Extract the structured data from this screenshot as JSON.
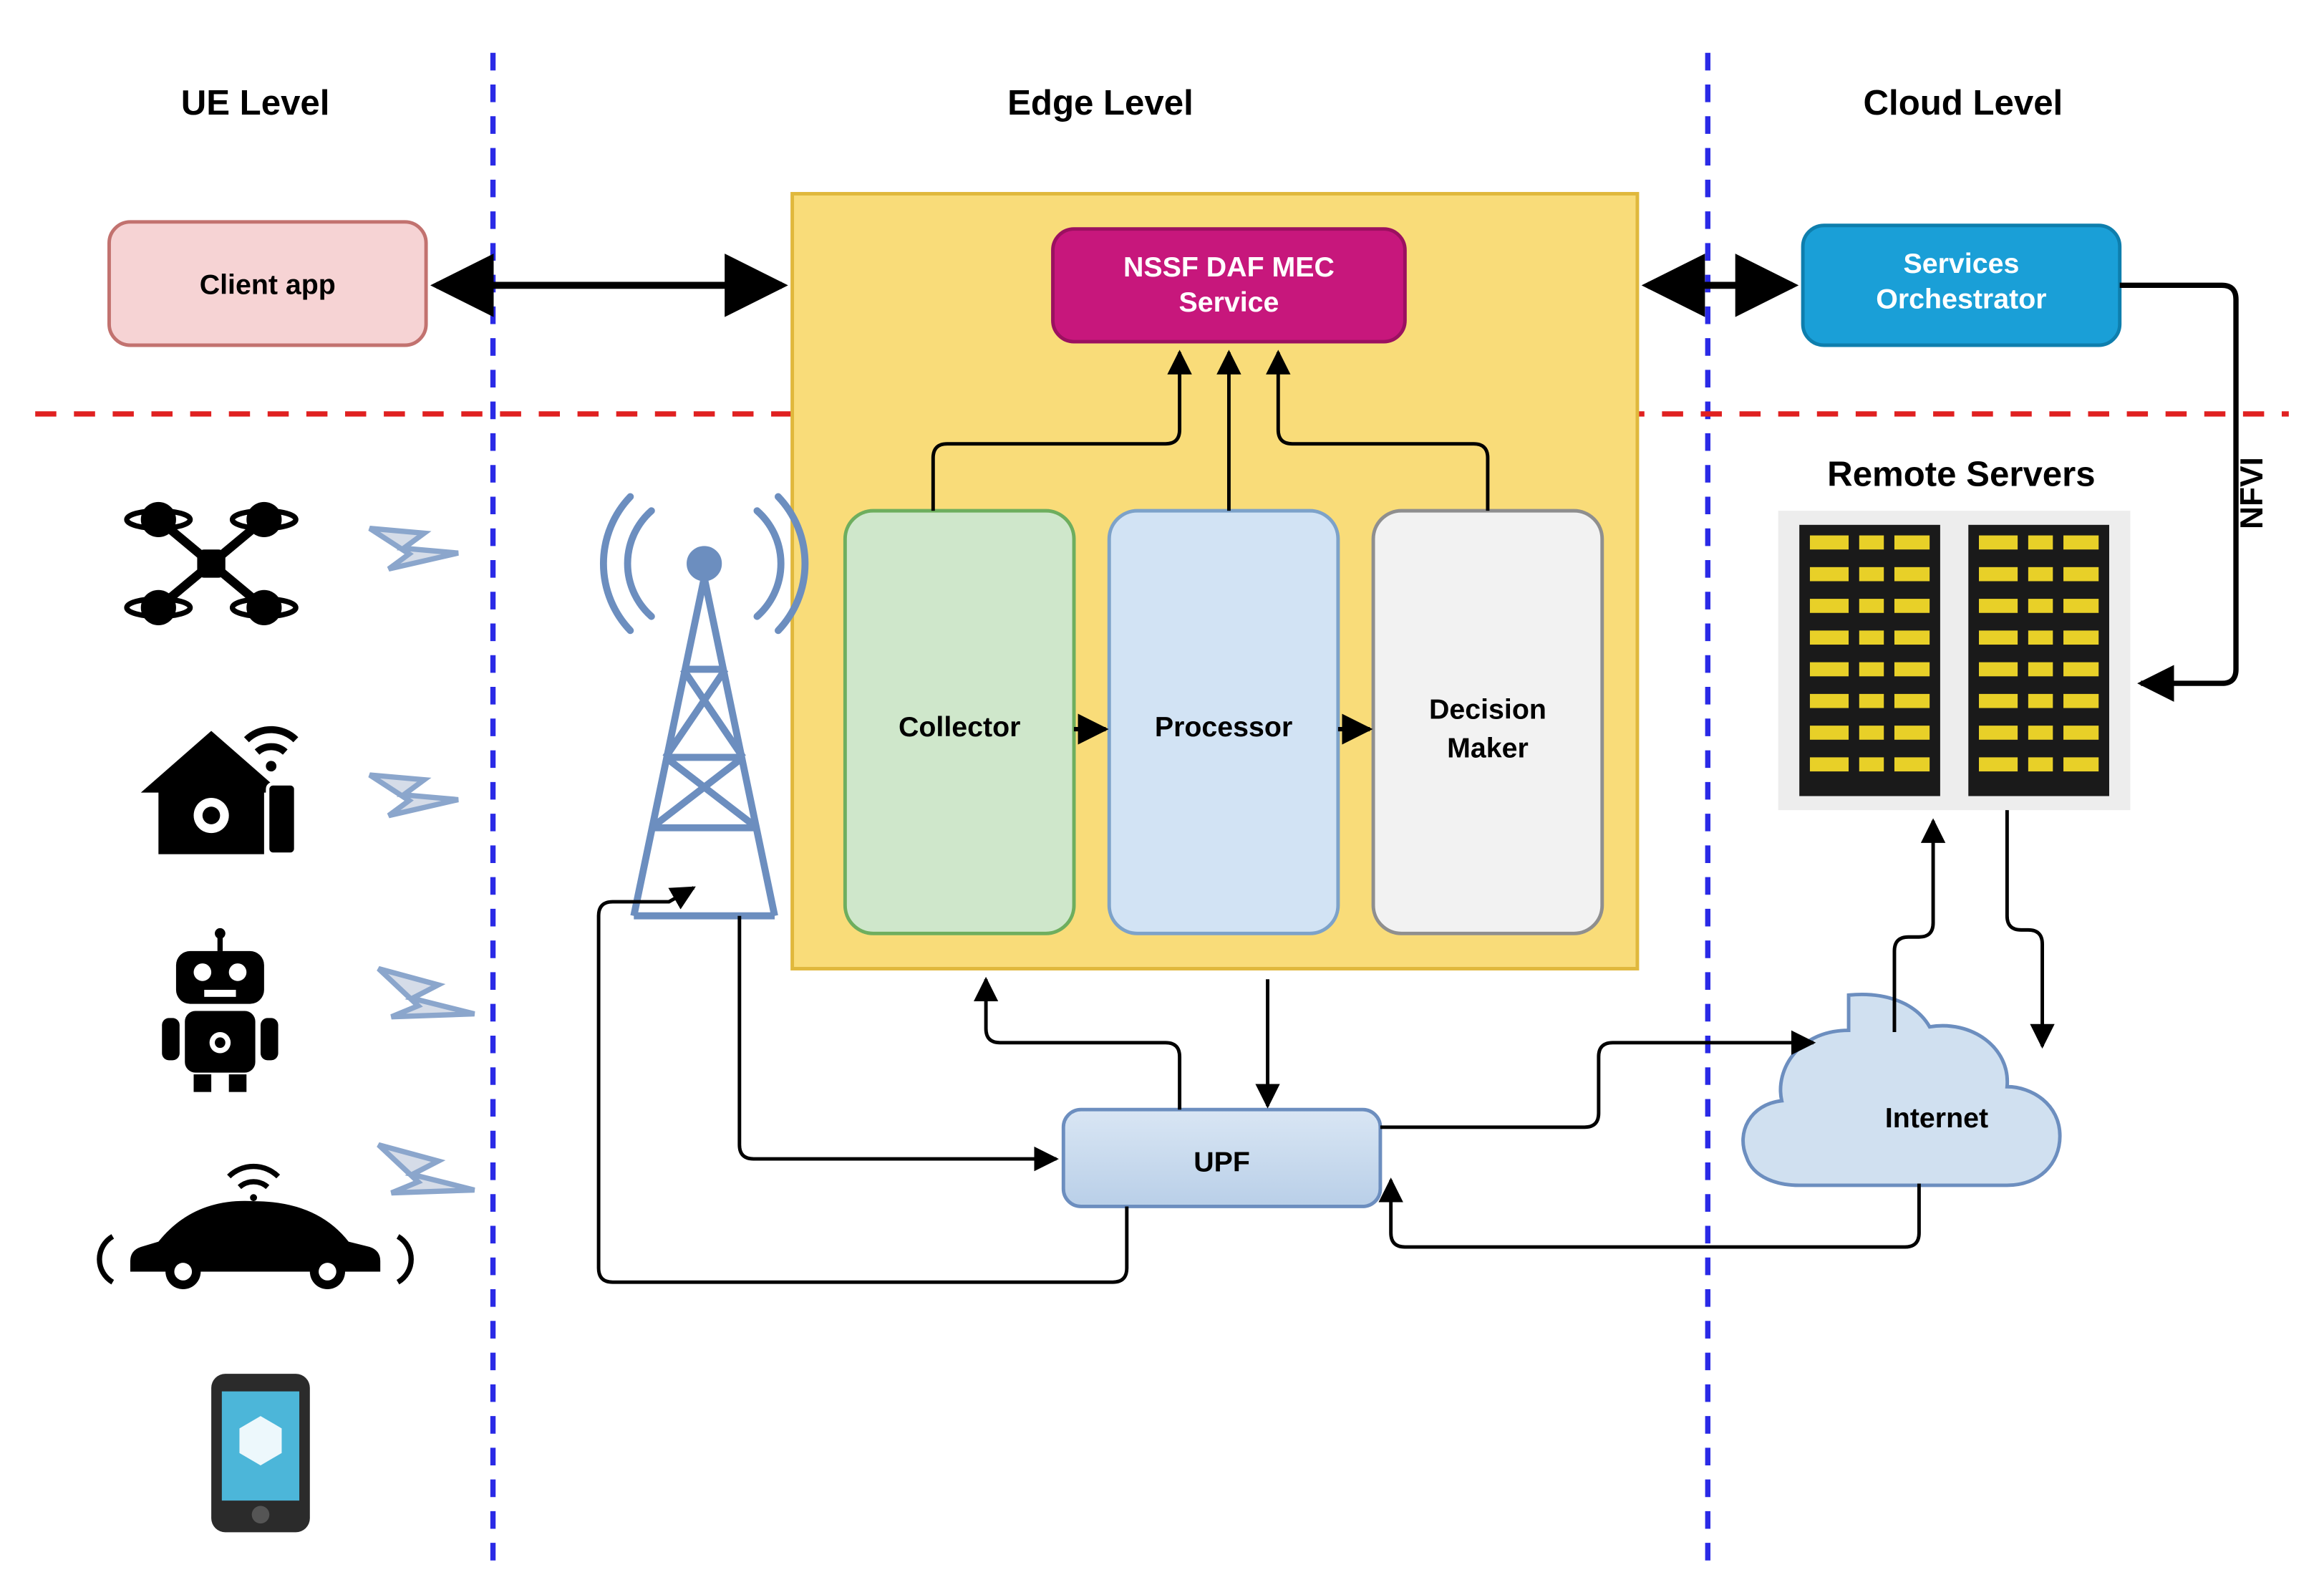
{
  "levels": {
    "ue": "UE Level",
    "edge": "Edge Level",
    "cloud": "Cloud Level"
  },
  "nodes": {
    "client_app": "Client app",
    "nssf_service": "NSSF DAF MEC Service",
    "services_orchestrator": "Services Orchestrator",
    "collector": "Collector",
    "processor": "Processor",
    "decision_maker": "Decision Maker",
    "upf": "UPF",
    "internet": "Internet",
    "remote_servers": "Remote Servers",
    "nfvi": "NFVI"
  },
  "icons": {
    "drone": "drone-icon",
    "smart_home": "smart-home-icon",
    "robot": "robot-icon",
    "car": "connected-car-icon",
    "phone": "smartphone-icon",
    "tower": "cell-tower-icon",
    "wireless": "wireless-signal-icon",
    "servers": "server-rack-icon",
    "cloud": "cloud-icon"
  },
  "colors": {
    "client_app_fill": "#F6D3D4",
    "client_app_stroke": "#C2726F",
    "edge_box_fill": "#F9DC79",
    "edge_box_stroke": "#E0B83C",
    "nssf_fill": "#C7177C",
    "nssf_text": "#FFFFFF",
    "orchestrator_fill": "#1A9FD7",
    "orchestrator_text": "#FFFFFF",
    "collector_fill": "#CFE7CB",
    "collector_stroke": "#6EAE5E",
    "processor_fill": "#D2E3F4",
    "processor_stroke": "#7DA2C9",
    "decision_fill": "#F2F2F2",
    "decision_stroke": "#8F8F8F",
    "upf_fill": "#C6D8EC",
    "upf_stroke": "#6C8EBF",
    "internet_fill": "#D0E0F0",
    "internet_stroke": "#6C8EBF",
    "divider_blue": "#2A2AE6",
    "divider_red": "#E02020",
    "tower_color": "#6C8EBF",
    "signal_color": "#8BA6CC"
  }
}
